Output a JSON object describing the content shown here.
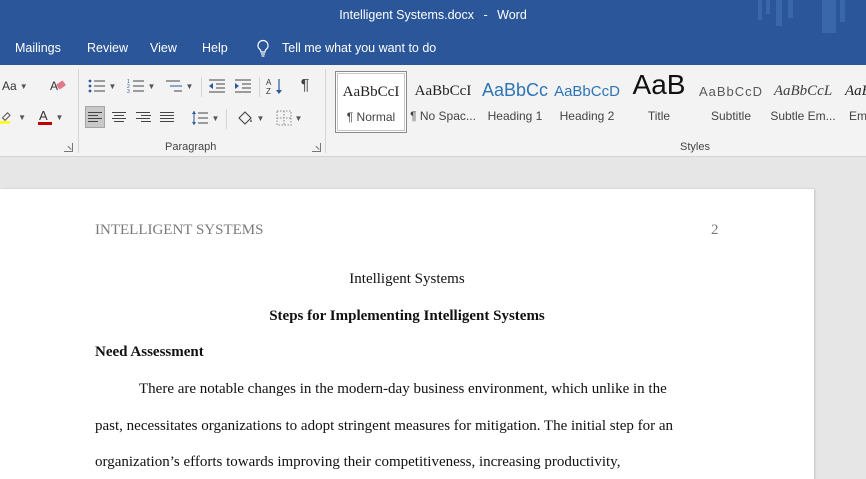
{
  "window": {
    "filename": "Intelligent Systems.docx",
    "separator": "-",
    "app": "Word"
  },
  "menu": {
    "tabs": [
      "Mailings",
      "Review",
      "View",
      "Help"
    ],
    "tellme": "Tell me what you want to do"
  },
  "ribbon": {
    "font_size_btn": "Aa",
    "paragraph_label": "Paragraph",
    "styles_label": "Styles",
    "styles": [
      {
        "preview": "AaBbCcI",
        "name": "¶ Normal"
      },
      {
        "preview": "AaBbCcI",
        "name": "¶ No Spac..."
      },
      {
        "preview": "AaBbCc",
        "name": "Heading 1"
      },
      {
        "preview": "AaBbCcD",
        "name": "Heading 2"
      },
      {
        "preview": "AaB",
        "name": "Title"
      },
      {
        "preview": "AaBbCcD",
        "name": "Subtitle"
      },
      {
        "preview": "AaBbCcL",
        "name": "Subtle Em..."
      },
      {
        "preview": "AaBl",
        "name": "Em"
      }
    ]
  },
  "colors": {
    "word_blue": "#2b579a",
    "highlight_yellow": "#ffff00",
    "font_red": "#c00000"
  },
  "document": {
    "running_head": "INTELLIGENT SYSTEMS",
    "page_number": "2",
    "title": "Intelligent Systems",
    "heading1": "Steps for Implementing Intelligent Systems",
    "heading2": "Need Assessment",
    "body_lines": [
      "There are notable changes in the modern-day business environment, which unlike in the",
      "past, necessitates organizations to adopt stringent measures for mitigation. The initial step for an",
      "organization’s efforts towards improving their competitiveness, increasing productivity,"
    ]
  }
}
